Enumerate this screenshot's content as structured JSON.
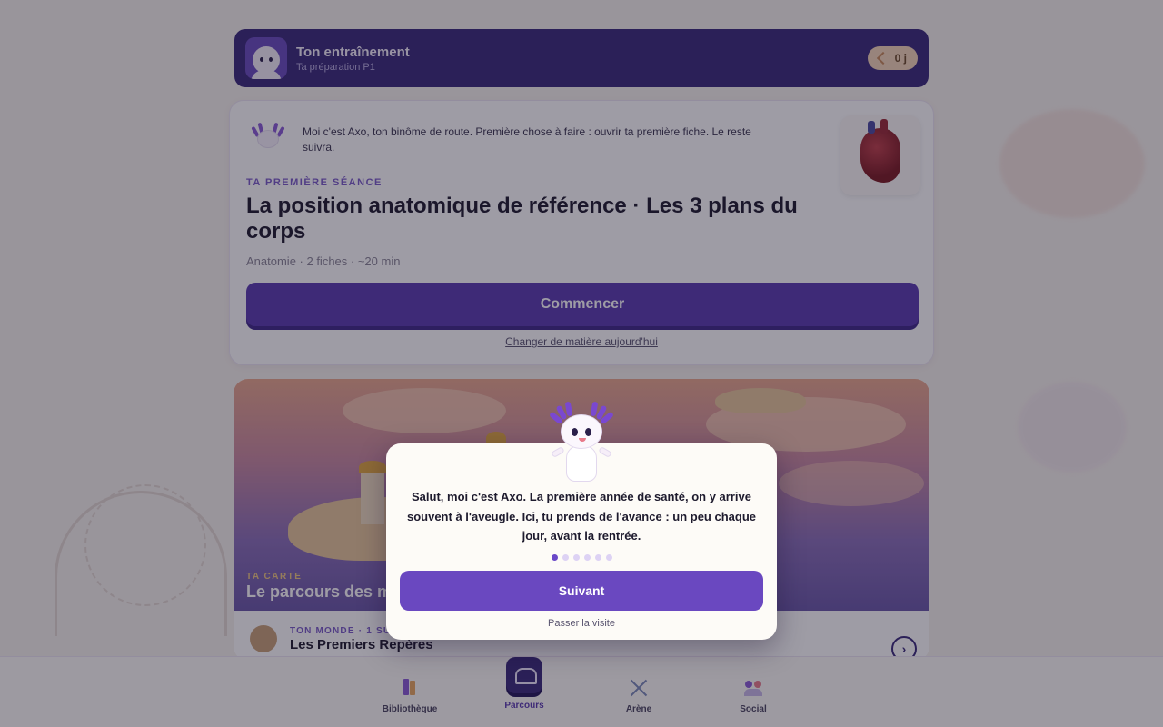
{
  "header": {
    "title": "Ton entraînement",
    "subtitle": "Ta préparation P1",
    "streak_value": "0 j"
  },
  "session": {
    "mascot_message": "Moi c'est Axo, ton binôme de route. Première chose à faire : ouvrir ta première fiche. Le reste suivra.",
    "kicker": "TA PREMIÈRE SÉANCE",
    "title": "La position anatomique de référence · Les 3 plans du corps",
    "meta": "Anatomie · 2 fiches · ~20 min",
    "start_label": "Commencer",
    "change_label": "Changer de matière aujourd'hui"
  },
  "map": {
    "kicker": "TA CARTE",
    "title": "Le parcours des m",
    "world_kicker": "TON MONDE · 1 SU",
    "world_name": "Les Premiers Repères",
    "arrow": "›"
  },
  "nav": {
    "items": [
      {
        "label": "Bibliothèque",
        "icon": "books-icon"
      },
      {
        "label": "Parcours",
        "icon": "map-icon",
        "active": true
      },
      {
        "label": "Arène",
        "icon": "swords-icon"
      },
      {
        "label": "Social",
        "icon": "people-icon"
      }
    ]
  },
  "dialog": {
    "text": "Salut, moi c'est Axo. La première année de santé, on y arrive souvent à l'aveugle. Ici, tu prends de l'avance : un peu chaque jour, avant la rentrée.",
    "step_current": 1,
    "step_total": 6,
    "next_label": "Suivant",
    "skip_label": "Passer la visite"
  },
  "colors": {
    "primary": "#5a3cb0",
    "header_bg": "#3a2a7a",
    "accent": "#7a5cc8"
  }
}
